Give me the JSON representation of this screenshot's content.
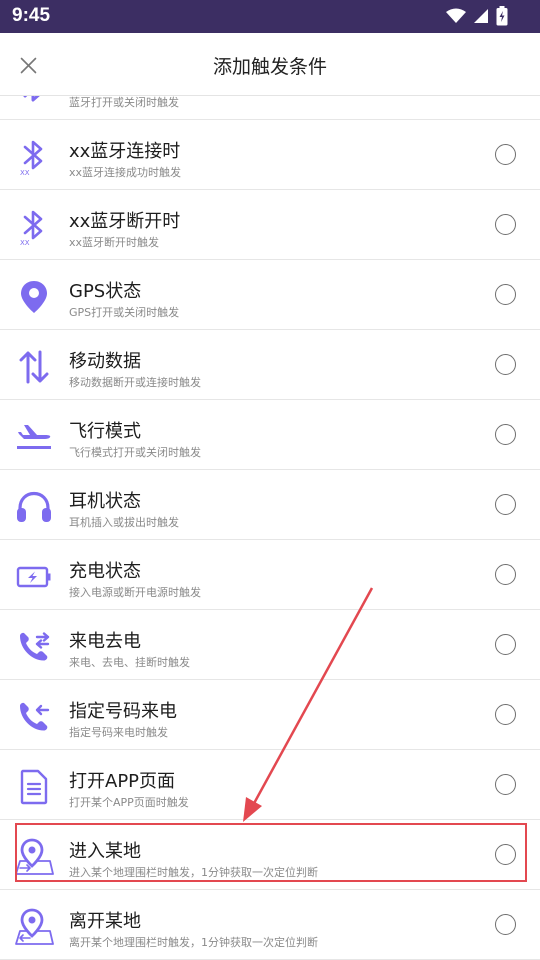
{
  "status_bar": {
    "time": "9:45"
  },
  "header": {
    "title": "添加触发条件"
  },
  "items": [
    {
      "title": "",
      "desc": "蓝牙打开或关闭时触发",
      "icon": "bluetooth-icon"
    },
    {
      "title": "xx蓝牙连接时",
      "desc": "xx蓝牙连接成功时触发",
      "icon": "bluetooth-device-icon"
    },
    {
      "title": "xx蓝牙断开时",
      "desc": "xx蓝牙断开时触发",
      "icon": "bluetooth-device-icon"
    },
    {
      "title": "GPS状态",
      "desc": "GPS打开或关闭时触发",
      "icon": "location-pin-icon"
    },
    {
      "title": "移动数据",
      "desc": "移动数据断开或连接时触发",
      "icon": "data-arrows-icon"
    },
    {
      "title": "飞行模式",
      "desc": "飞行模式打开或关闭时触发",
      "icon": "airplane-icon"
    },
    {
      "title": "耳机状态",
      "desc": "耳机插入或拔出时触发",
      "icon": "headset-icon"
    },
    {
      "title": "充电状态",
      "desc": "接入电源或断开电源时触发",
      "icon": "battery-charging-icon"
    },
    {
      "title": "来电去电",
      "desc": "来电、去电、挂断时触发",
      "icon": "phone-call-icon"
    },
    {
      "title": "指定号码来电",
      "desc": "指定号码来电时触发",
      "icon": "phone-incoming-icon"
    },
    {
      "title": "打开APP页面",
      "desc": "打开某个APP页面时触发",
      "icon": "document-icon"
    },
    {
      "title": "进入某地",
      "desc": "进入某个地理围栏时触发，1分钟获取一次定位判断",
      "icon": "enter-place-icon"
    },
    {
      "title": "离开某地",
      "desc": "离开某个地理围栏时触发，1分钟获取一次定位判断",
      "icon": "leave-place-icon"
    }
  ],
  "colors": {
    "accent": "#7d6bef",
    "status_bar": "#3c2e63",
    "highlight": "#e34850"
  }
}
